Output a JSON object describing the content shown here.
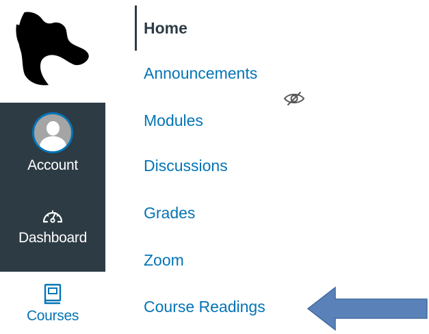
{
  "global_nav": {
    "logo_icon": "horse-head-logo",
    "account_label": "Account",
    "dashboard_label": "Dashboard",
    "courses_label": "Courses",
    "accent_color": "#0374b5",
    "dark_bg_color": "#2d3b45"
  },
  "course_nav": {
    "items": [
      {
        "label": "Home",
        "active": true
      },
      {
        "label": "Announcements",
        "hidden_icon": "eye-slash-icon"
      },
      {
        "label": "Modules"
      },
      {
        "label": "Discussions"
      },
      {
        "label": "Grades"
      },
      {
        "label": "Zoom"
      },
      {
        "label": "Course Readings"
      }
    ]
  },
  "annotation": {
    "arrow_icon": "left-arrow-pointer",
    "arrow_color": "#5a82b8"
  }
}
